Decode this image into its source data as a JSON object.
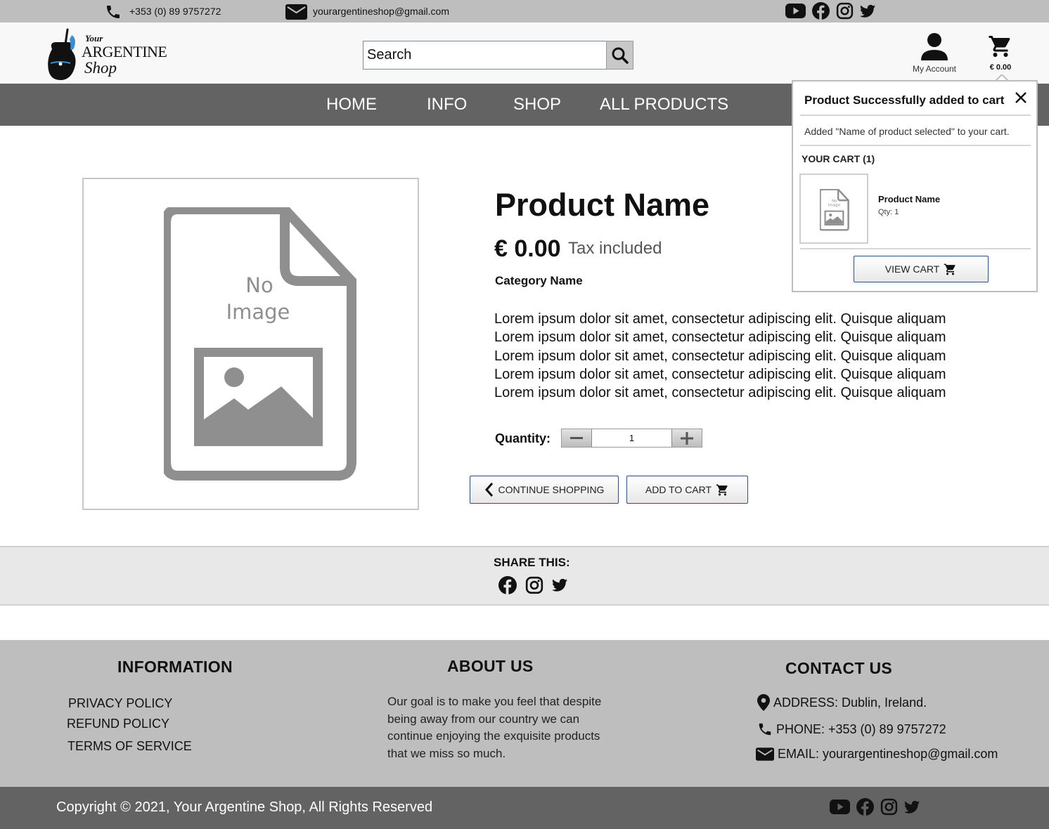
{
  "topbar": {
    "phone": "+353 (0) 89 9757272",
    "email": "yourargentineshop@gmail.com",
    "social": [
      "youtube-icon",
      "facebook-icon",
      "instagram-icon",
      "twitter-icon"
    ]
  },
  "logo": {
    "line1": "Your",
    "line2": "ARGENTINE",
    "line3": "Shop"
  },
  "search": {
    "placeholder": "Search",
    "button_icon": "search-icon"
  },
  "header": {
    "account_label": "My Account",
    "cart_total": "€ 0.00"
  },
  "nav": {
    "items": [
      "HOME",
      "INFO",
      "SHOP",
      "ALL PRODUCTS"
    ]
  },
  "product": {
    "image_text_line1": "No",
    "image_text_line2": "Image",
    "name": "Product Name",
    "price": "€ 0.00",
    "tax_note": "Tax included",
    "category": "Category Name",
    "description": [
      "Lorem ipsum dolor sit amet, consectetur adipiscing elit. Quisque aliquam",
      "Lorem ipsum dolor sit amet, consectetur adipiscing elit. Quisque aliquam",
      "Lorem ipsum dolor sit amet, consectetur adipiscing elit. Quisque aliquam",
      "Lorem ipsum dolor sit amet, consectetur adipiscing elit. Quisque aliquam",
      "Lorem ipsum dolor sit amet, consectetur adipiscing elit. Quisque aliquam"
    ],
    "quantity_label": "Quantity:",
    "quantity": "1",
    "continue_label": "CONTINUE SHOPPING",
    "add_to_cart_label": "ADD TO CART"
  },
  "share": {
    "title": "SHARE THIS:",
    "icons": [
      "facebook-icon",
      "instagram-icon",
      "twitter-icon"
    ]
  },
  "footer": {
    "information": {
      "title": "INFORMATION",
      "links": [
        "PRIVACY POLICY",
        "REFUND POLICY",
        "TERMS OF SERVICE"
      ]
    },
    "about": {
      "title": "ABOUT US",
      "text": "Our goal is to make you feel that despite being away from our country we can continue enjoying the exquisite products that we miss so much."
    },
    "contact": {
      "title": "CONTACT US",
      "address": "ADDRESS: Dublin, Ireland.",
      "phone": "PHONE: +353 (0) 89 9757272",
      "email": "EMAIL: yourargentineshop@gmail.com"
    },
    "copyright": "Copyright © 2021, Your Argentine Shop, All Rights Reserved"
  },
  "popup": {
    "title": "Product Successfully added to cart",
    "message": "Added \"Name of product selected\" to your cart.",
    "cart_heading": "YOUR CART (1)",
    "item_thumb_line1": "No",
    "item_thumb_line2": "Image",
    "item_name": "Product Name",
    "item_qty": "Qty: 1",
    "view_cart_label": "VIEW CART"
  },
  "colors": {
    "topbar_bg": "#bebebe",
    "nav_bg": "#636363",
    "footer_bg": "#bebebe",
    "button_border": "#2d4f78",
    "placeholder_gray": "#8f8f8f"
  }
}
